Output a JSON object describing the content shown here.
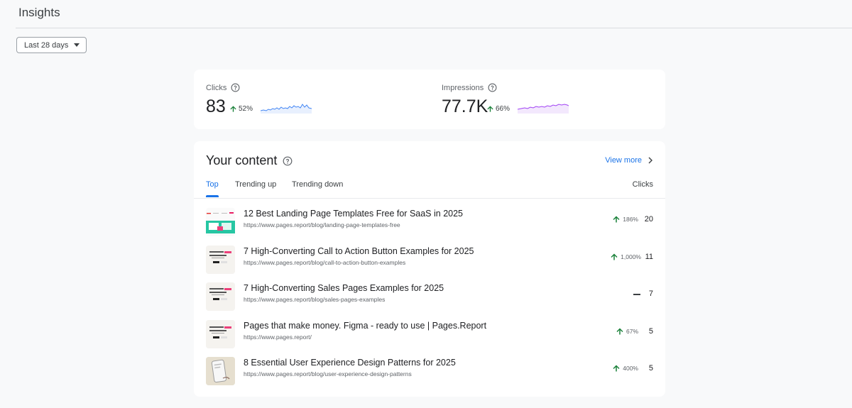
{
  "header": {
    "title": "Insights"
  },
  "filter": {
    "date_range": "Last 28 days"
  },
  "metrics": {
    "clicks": {
      "label": "Clicks",
      "value": "83",
      "change": "52%"
    },
    "impressions": {
      "label": "Impressions",
      "value": "77.7K",
      "change": "66%"
    }
  },
  "content": {
    "title": "Your content",
    "view_more": "View more",
    "tabs": [
      "Top",
      "Trending up",
      "Trending down"
    ],
    "active_tab": "Top",
    "column_header": "Clicks",
    "rows": [
      {
        "title": "12 Best Landing Page Templates Free for SaaS in 2025",
        "url": "https://www.pages.report/blog/landing-page-templates-free",
        "change": "186%",
        "trend": "up",
        "clicks": "20"
      },
      {
        "title": "7 High-Converting Call to Action Button Examples for 2025",
        "url": "https://www.pages.report/blog/call-to-action-button-examples",
        "change": "1,000%",
        "trend": "up",
        "clicks": "11"
      },
      {
        "title": "7 High-Converting Sales Pages Examples for 2025",
        "url": "https://www.pages.report/blog/sales-pages-examples",
        "change": "",
        "trend": "flat",
        "clicks": "7"
      },
      {
        "title": "Pages that make money. Figma - ready to use | Pages.Report",
        "url": "https://www.pages.report/",
        "change": "67%",
        "trend": "up",
        "clicks": "5"
      },
      {
        "title": "8 Essential User Experience Design Patterns for 2025",
        "url": "https://www.pages.report/blog/user-experience-design-patterns",
        "change": "400%",
        "trend": "up",
        "clicks": "5"
      }
    ]
  },
  "colors": {
    "accent": "#1a73e8",
    "up_arrow": "#188038",
    "clicks_sparkline": "#4285f4",
    "impressions_sparkline": "#a142f4"
  }
}
